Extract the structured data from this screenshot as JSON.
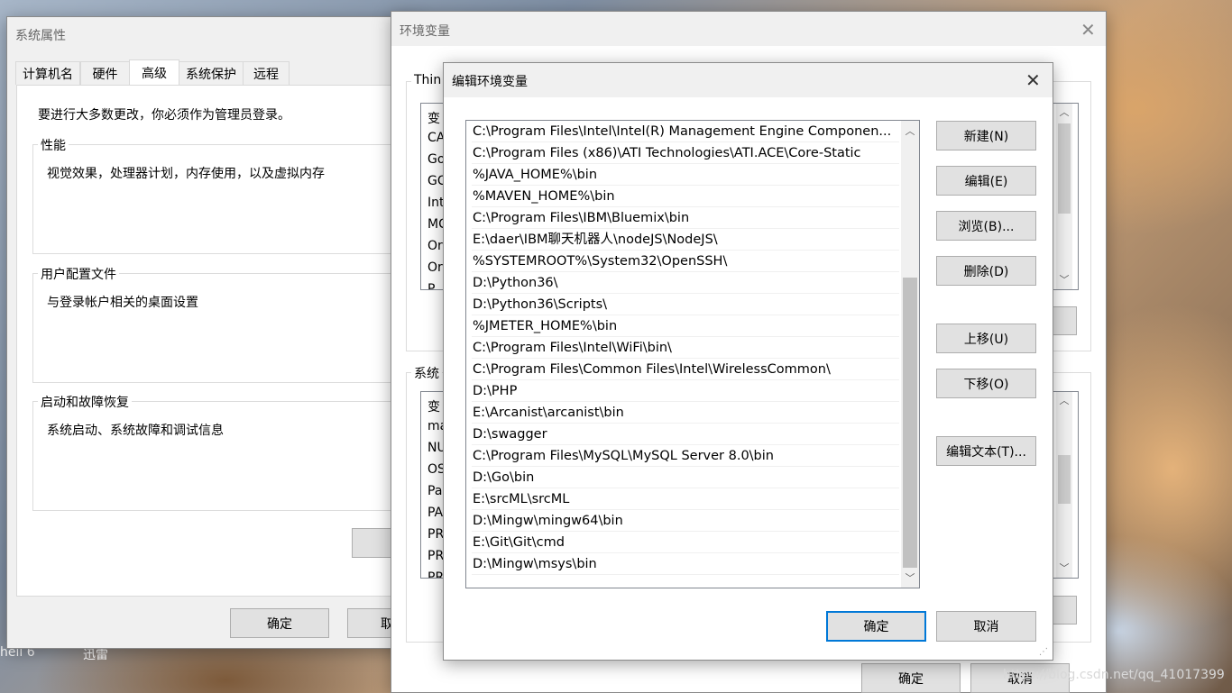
{
  "desktop": {
    "label_bottom_left": "hell 6",
    "label_thunder": "迅雷",
    "watermark": "https://blog.csdn.net/qq_41017399"
  },
  "sysprops": {
    "title": "系统属性",
    "tabs": [
      "计算机名",
      "硬件",
      "高级",
      "系统保护",
      "远程"
    ],
    "admin_note": "要进行大多数更改，你必须作为管理员登录。",
    "perf_label": "性能",
    "perf_desc": "视觉效果，处理器计划，内存使用，以及虚拟内存",
    "profile_label": "用户配置文件",
    "profile_desc": "与登录帐户相关的桌面设置",
    "startup_label": "启动和故障恢复",
    "startup_desc": "系统启动、系统故障和调试信息",
    "ok": "确定",
    "cancel_partial": "取"
  },
  "envvars": {
    "title": "环境变量",
    "user_group_partial": "Thin",
    "user_vars_partial": [
      "变",
      "CA",
      "Go",
      "GC",
      "Int",
      "MC",
      "Or",
      "Or",
      "P"
    ],
    "sys_group_partial": "系统",
    "sys_vars_partial": [
      "变",
      "ma",
      "NU",
      "OS",
      "Pa",
      "PA",
      "PR",
      "PR",
      "PR"
    ],
    "ok": "确定",
    "cancel": "取消"
  },
  "editenv": {
    "title": "编辑环境变量",
    "paths": [
      "C:\\Program Files\\Intel\\Intel(R) Management Engine Componen...",
      "C:\\Program Files (x86)\\ATI Technologies\\ATI.ACE\\Core-Static",
      "%JAVA_HOME%\\bin",
      "%MAVEN_HOME%\\bin",
      "C:\\Program Files\\IBM\\Bluemix\\bin",
      "E:\\daer\\IBM聊天机器人\\nodeJS\\NodeJS\\",
      "%SYSTEMROOT%\\System32\\OpenSSH\\",
      "D:\\Python36\\",
      "D:\\Python36\\Scripts\\",
      "%JMETER_HOME%\\bin",
      "C:\\Program Files\\Intel\\WiFi\\bin\\",
      "C:\\Program Files\\Common Files\\Intel\\WirelessCommon\\",
      "D:\\PHP",
      "E:\\Arcanist\\arcanist\\bin",
      "D:\\swagger",
      "C:\\Program Files\\MySQL\\MySQL Server 8.0\\bin",
      "D:\\Go\\bin",
      "E:\\srcML\\srcML",
      "D:\\Mingw\\mingw64\\bin",
      "E:\\Git\\Git\\cmd",
      "D:\\Mingw\\msys\\bin"
    ],
    "buttons": {
      "new": "新建(N)",
      "edit": "编辑(E)",
      "browse": "浏览(B)...",
      "delete": "删除(D)",
      "move_up": "上移(U)",
      "move_down": "下移(O)",
      "edit_text": "编辑文本(T)..."
    },
    "ok": "确定",
    "cancel": "取消"
  }
}
